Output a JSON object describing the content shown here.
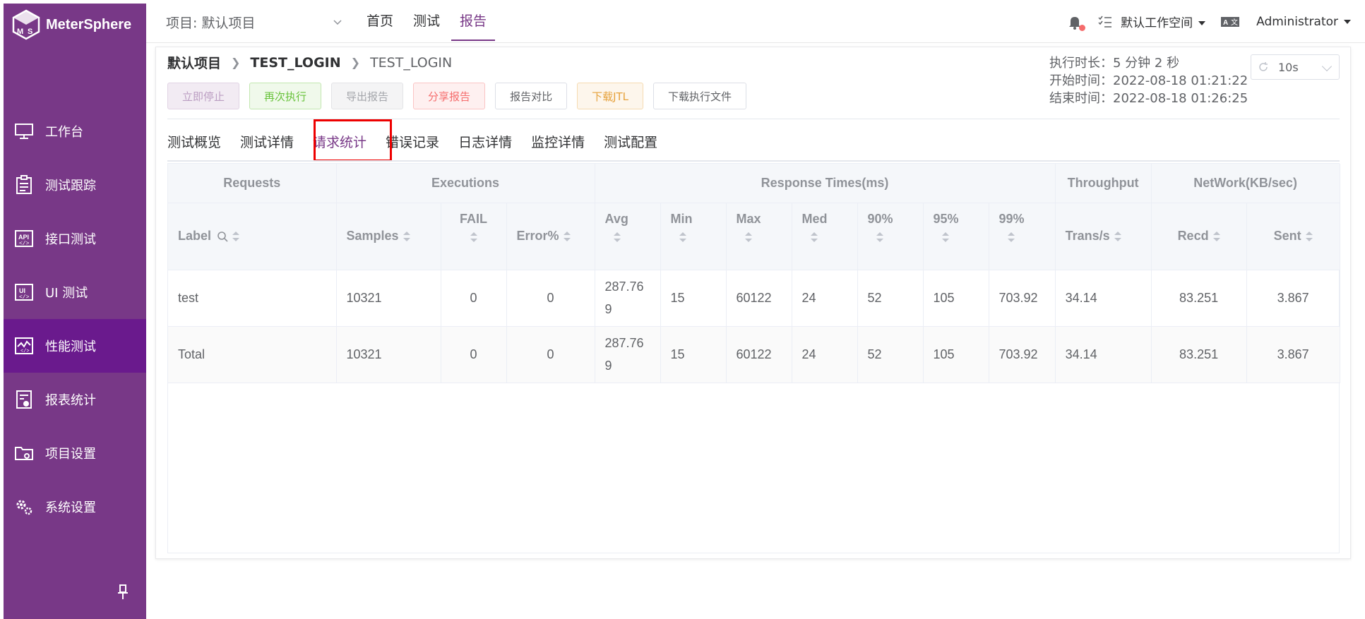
{
  "app": {
    "name": "MeterSphere"
  },
  "sidebar": {
    "items": [
      {
        "label": "工作台",
        "icon": "monitor-icon"
      },
      {
        "label": "测试跟踪",
        "icon": "clipboard-icon"
      },
      {
        "label": "接口测试",
        "icon": "api-icon"
      },
      {
        "label": "UI 测试",
        "icon": "ui-icon"
      },
      {
        "label": "性能测试",
        "icon": "performance-chart-icon"
      },
      {
        "label": "报表统计",
        "icon": "report-icon"
      },
      {
        "label": "项目设置",
        "icon": "folder-gear-icon"
      },
      {
        "label": "系统设置",
        "icon": "gears-icon"
      }
    ],
    "active_index": 4
  },
  "header": {
    "project": "项目: 默认项目",
    "menu": [
      "首页",
      "测试",
      "报告"
    ],
    "active_menu": "报告",
    "workspace": "默认工作空间",
    "user": "Administrator"
  },
  "breadcrumb": {
    "project": "默认项目",
    "test": "TEST_LOGIN",
    "report": "TEST_LOGIN"
  },
  "buttons": {
    "stop": "立即停止",
    "rerun": "再次执行",
    "export": "导出报告",
    "share": "分享报告",
    "compare": "报告对比",
    "download_jtl": "下载JTL",
    "download_files": "下载执行文件"
  },
  "run_info": {
    "duration": "执行时长：5 分钟 2 秒",
    "start": "开始时间：2022-08-18 01:21:22",
    "end": "结束时间：2022-08-18 01:26:25",
    "refresh": "10s"
  },
  "tabs": [
    "测试概览",
    "测试详情",
    "请求统计",
    "错误记录",
    "日志详情",
    "监控详情",
    "测试配置"
  ],
  "active_tab": "请求统计",
  "table": {
    "groups": {
      "requests": "Requests",
      "executions": "Executions",
      "response": "Response Times(ms)",
      "throughput": "Throughput",
      "network": "NetWork(KB/sec)"
    },
    "columns": {
      "label": "Label",
      "samples": "Samples",
      "fail": "FAIL",
      "error": "Error%",
      "avg": "Avg",
      "min": "Min",
      "max": "Max",
      "med": "Med",
      "p90": "90%",
      "p95": "95%",
      "p99": "99%",
      "trans": "Trans/s",
      "recd": "Recd",
      "sent": "Sent"
    },
    "rows": [
      {
        "label": "test",
        "samples": "10321",
        "fail": "0",
        "error": "0",
        "avg_1": "287.76",
        "avg_2": "9",
        "min": "15",
        "max": "60122",
        "med": "24",
        "p90": "52",
        "p95": "105",
        "p99": "703.92",
        "trans": "34.14",
        "recd": "83.251",
        "sent": "3.867"
      },
      {
        "label": "Total",
        "samples": "10321",
        "fail": "0",
        "error": "0",
        "avg_1": "287.76",
        "avg_2": "9",
        "min": "15",
        "max": "60122",
        "med": "24",
        "p90": "52",
        "p95": "105",
        "p99": "703.92",
        "trans": "34.14",
        "recd": "83.251",
        "sent": "3.867"
      }
    ]
  },
  "colors": {
    "brand": "#783887",
    "sidebar_active": "#6a1a8d",
    "highlight": "#e00000"
  }
}
